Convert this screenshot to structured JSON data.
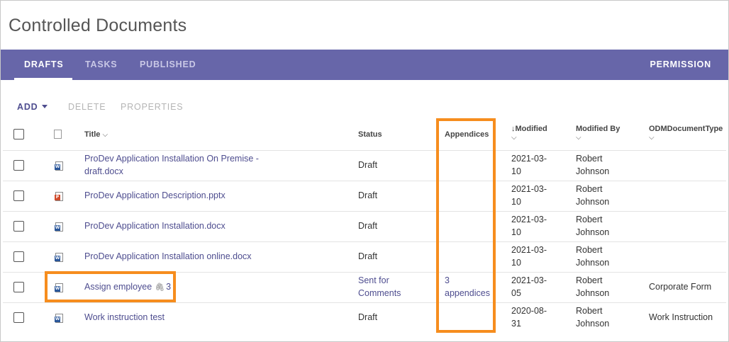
{
  "page": {
    "title": "Controlled Documents"
  },
  "tabs": [
    {
      "label": "DRAFTS",
      "active": true
    },
    {
      "label": "TASKS",
      "active": false
    },
    {
      "label": "PUBLISHED",
      "active": false
    }
  ],
  "permission_label": "PERMISSION",
  "toolbar": {
    "add_label": "ADD",
    "delete_label": "DELETE",
    "properties_label": "PROPERTIES"
  },
  "columns": {
    "title": "Title",
    "status": "Status",
    "appendices": "Appendices",
    "modified": "Modified",
    "modified_by": "Modified By",
    "doc_type": "ODMDocumentType"
  },
  "rows": [
    {
      "icon": "word-doc-icon",
      "title_l1": "ProDev Application Installation On Premise -",
      "title_l2": "draft.docx",
      "attachments": "",
      "status_l1": "Draft",
      "status_l2": "",
      "app_l1": "",
      "app_l2": "",
      "mod_l1": "2021-03-",
      "mod_l2": "10",
      "by_l1": "Robert",
      "by_l2": "Johnson",
      "type": ""
    },
    {
      "icon": "powerpoint-doc-icon",
      "title_l1": "ProDev Application Description.pptx",
      "title_l2": "",
      "attachments": "",
      "status_l1": "Draft",
      "status_l2": "",
      "app_l1": "",
      "app_l2": "",
      "mod_l1": "2021-03-",
      "mod_l2": "10",
      "by_l1": "Robert",
      "by_l2": "Johnson",
      "type": ""
    },
    {
      "icon": "word-doc-icon",
      "title_l1": "ProDev Application Installation.docx",
      "title_l2": "",
      "attachments": "",
      "status_l1": "Draft",
      "status_l2": "",
      "app_l1": "",
      "app_l2": "",
      "mod_l1": "2021-03-",
      "mod_l2": "10",
      "by_l1": "Robert",
      "by_l2": "Johnson",
      "type": ""
    },
    {
      "icon": "word-doc-icon",
      "title_l1": "ProDev Application Installation online.docx",
      "title_l2": "",
      "attachments": "",
      "status_l1": "Draft",
      "status_l2": "",
      "app_l1": "",
      "app_l2": "",
      "mod_l1": "2021-03-",
      "mod_l2": "10",
      "by_l1": "Robert",
      "by_l2": "Johnson",
      "type": ""
    },
    {
      "icon": "word-doc-icon",
      "title_l1": "Assign employee",
      "title_l2": "",
      "attachments": "3",
      "status_l1": "Sent for",
      "status_l2": "Comments",
      "app_l1": "3",
      "app_l2": "appendices",
      "mod_l1": "2021-03-",
      "mod_l2": "05",
      "by_l1": "Robert",
      "by_l2": "Johnson",
      "type": "Corporate Form"
    },
    {
      "icon": "word-doc-icon",
      "title_l1": "Work instruction test",
      "title_l2": "",
      "attachments": "",
      "status_l1": "Draft",
      "status_l2": "",
      "app_l1": "",
      "app_l2": "",
      "mod_l1": "2020-08-",
      "mod_l2": "31",
      "by_l1": "Robert",
      "by_l2": "Johnson",
      "type": "Work Instruction"
    }
  ],
  "colors": {
    "tabbar": "#6766a9",
    "link": "#4e4d8f",
    "highlight": "#f68d1e"
  }
}
